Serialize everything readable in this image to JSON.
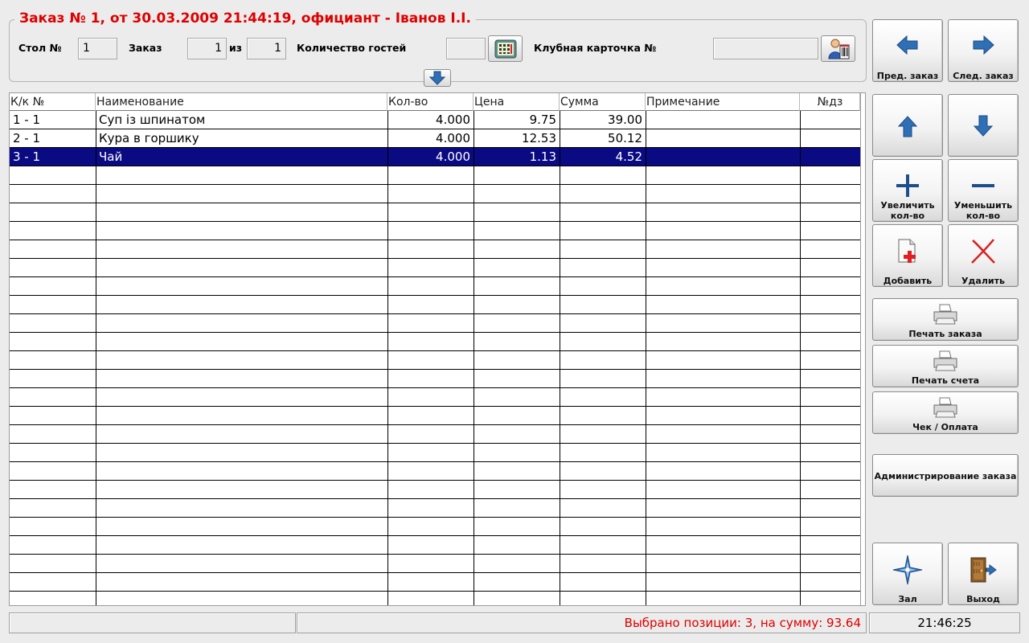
{
  "header": {
    "title": "Заказ № 1, от 30.03.2009 21:44:19, официант - Іванов І.І.",
    "table_label": "Стол №",
    "table_value": "1",
    "order_label": "Заказ",
    "order_value": "1",
    "of_label": "из",
    "order_total": "1",
    "guests_label": "Количество гостей",
    "guests_value": "",
    "club_card_label": "Клубная карточка №",
    "club_card_value": ""
  },
  "table": {
    "columns": [
      "К/к №",
      "Наименование",
      "Кол-во",
      "Цена",
      "Сумма",
      "Примечание",
      "№дз"
    ],
    "rows": [
      {
        "kk": "1 - 1",
        "name": "Суп із шпинатом",
        "qty": "4.000",
        "price": "9.75",
        "sum": "39.00",
        "note": "",
        "dz": ""
      },
      {
        "kk": "2 - 1",
        "name": "Кура в горшику",
        "qty": "4.000",
        "price": "12.53",
        "sum": "50.12",
        "note": "",
        "dz": ""
      },
      {
        "kk": "3 - 1",
        "name": "Чай",
        "qty": "4.000",
        "price": "1.13",
        "sum": "4.52",
        "note": "",
        "dz": ""
      }
    ],
    "selected_row": 2
  },
  "buttons": {
    "prev_order": "Пред. заказ",
    "next_order": "След. заказ",
    "increase_1": "Увеличить",
    "increase_2": "кол-во",
    "decrease_1": "Уменьшить",
    "decrease_2": "кол-во",
    "add": "Добавить",
    "delete": "Удалить",
    "print_order": "Печать заказа",
    "print_bill": "Печать счета",
    "check_pay": "Чек / Оплата",
    "admin_order": "Администрирование заказа",
    "hall": "Зал",
    "exit": "Выход"
  },
  "status": {
    "left": "",
    "summary": "Выбрано позиции: 3, на сумму: 93.64",
    "time": "21:46:25"
  },
  "colors": {
    "title": "#e00000",
    "selection": "#0a0a82",
    "accent_blue": "#2f6fb5"
  }
}
